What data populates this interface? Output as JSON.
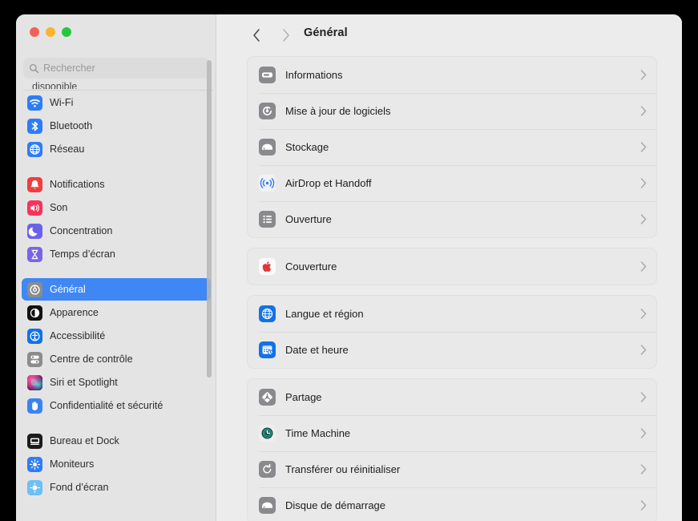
{
  "window": {
    "traffic_lights": [
      "close",
      "minimize",
      "maximize"
    ],
    "colors": {
      "accent": "#3f87f5",
      "sidebar_bg": "#e4e4e4",
      "main_bg": "#ececec",
      "group_bg": "#e9e9e9"
    }
  },
  "search": {
    "placeholder": "Rechercher",
    "value": "",
    "icon": "search-icon"
  },
  "sidebar": {
    "scrolled_remnant": "disponible",
    "groups": [
      {
        "items": [
          {
            "label": "Wi-Fi",
            "icon": "wifi-icon",
            "color": "#2f7cf6",
            "selected": false
          },
          {
            "label": "Bluetooth",
            "icon": "bluetooth-icon",
            "color": "#2f7cf6",
            "selected": false
          },
          {
            "label": "Réseau",
            "icon": "globe-network-icon",
            "color": "#2f7cf6",
            "selected": false
          }
        ]
      },
      {
        "items": [
          {
            "label": "Notifications",
            "icon": "bell-icon",
            "color": "#f03e3e",
            "selected": false
          },
          {
            "label": "Son",
            "icon": "speaker-icon",
            "color": "#f7325b",
            "selected": false
          },
          {
            "label": "Concentration",
            "icon": "moon-icon",
            "color": "#6b62ea",
            "selected": false
          },
          {
            "label": "Temps d’écran",
            "icon": "hourglass-icon",
            "color": "#7b63e8",
            "selected": false
          }
        ]
      },
      {
        "items": [
          {
            "label": "Général",
            "icon": "gear-icon",
            "color": "#8c8c8c",
            "selected": true
          },
          {
            "label": "Apparence",
            "icon": "appearance-icon",
            "color": "#121212",
            "selected": false
          },
          {
            "label": "Accessibilité",
            "icon": "accessibility-icon",
            "color": "#1272e8",
            "selected": false
          },
          {
            "label": "Centre de contrôle",
            "icon": "control-center-icon",
            "color": "#8c8c8c",
            "selected": false
          },
          {
            "label": "Siri et Spotlight",
            "icon": "siri-icon",
            "color": "#4a2d6b",
            "selected": false
          },
          {
            "label": "Confidentialité et sécurité",
            "icon": "hand-privacy-icon",
            "color": "#3a84f2",
            "selected": false
          }
        ]
      },
      {
        "items": [
          {
            "label": "Bureau et Dock",
            "icon": "desktop-dock-icon",
            "color": "#1c1c1c",
            "selected": false
          },
          {
            "label": "Moniteurs",
            "icon": "display-icon",
            "color": "#2f7cf6",
            "selected": false
          },
          {
            "label": "Fond d’écran",
            "icon": "wallpaper-icon",
            "color": "#6cc0f5",
            "selected": false
          }
        ]
      }
    ]
  },
  "toolbar": {
    "title": "Général",
    "back_icon": "chevron-left-icon",
    "forward_icon": "chevron-right-icon",
    "back_enabled": true,
    "forward_enabled": false
  },
  "main": {
    "groups": [
      {
        "rows": [
          {
            "label": "Informations",
            "icon": "info-mac-icon",
            "color": "#8a8a8e"
          },
          {
            "label": "Mise à jour de logiciels",
            "icon": "software-update-icon",
            "color": "#8a8a8e"
          },
          {
            "label": "Stockage",
            "icon": "storage-icon",
            "color": "#8a8a8e"
          },
          {
            "label": "AirDrop et Handoff",
            "icon": "airdrop-icon",
            "color": "#f2f2f2"
          },
          {
            "label": "Ouverture",
            "icon": "login-items-icon",
            "color": "#8a8a8e"
          }
        ]
      },
      {
        "rows": [
          {
            "label": "Couverture",
            "icon": "apple-logo-icon",
            "color": "#fafafa"
          }
        ]
      },
      {
        "rows": [
          {
            "label": "Langue et région",
            "icon": "language-globe-icon",
            "color": "#1272e8"
          },
          {
            "label": "Date et heure",
            "icon": "date-time-icon",
            "color": "#1272e8"
          }
        ]
      },
      {
        "rows": [
          {
            "label": "Partage",
            "icon": "sharing-icon",
            "color": "#8a8a8e"
          },
          {
            "label": "Time Machine",
            "icon": "time-machine-icon",
            "color": "#eeeeee"
          },
          {
            "label": "Transférer ou réinitialiser",
            "icon": "transfer-reset-icon",
            "color": "#8a8a8e"
          },
          {
            "label": "Disque de démarrage",
            "icon": "startup-disk-icon",
            "color": "#8a8a8e"
          }
        ]
      }
    ]
  }
}
